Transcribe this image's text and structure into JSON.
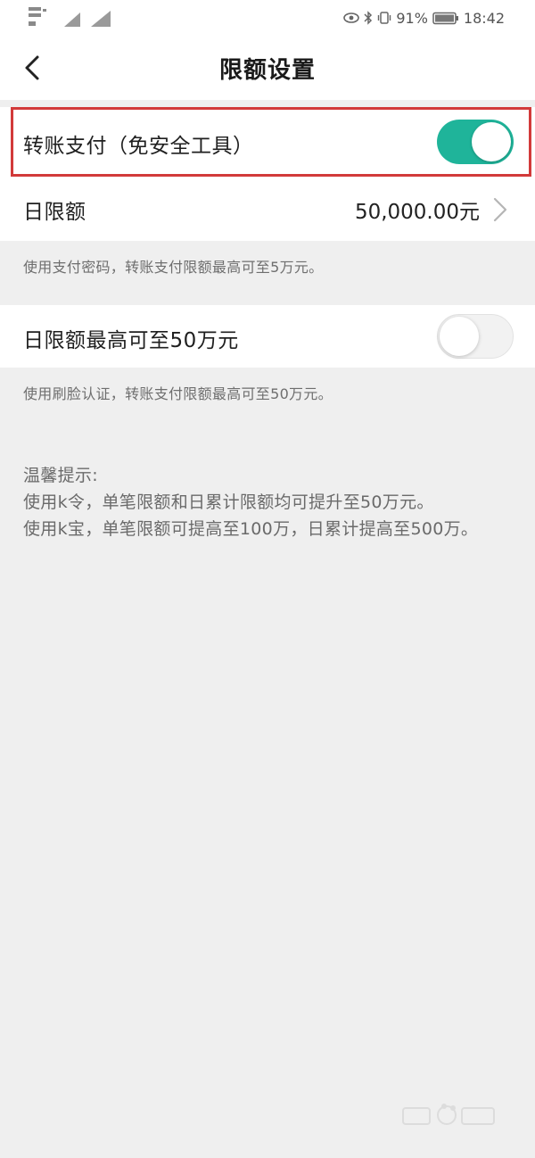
{
  "status_bar": {
    "battery_percent": "91%",
    "time": "18:42",
    "icons": [
      "signal-icon",
      "eye-icon",
      "bluetooth-icon",
      "vibrate-icon",
      "battery-icon"
    ]
  },
  "header": {
    "title": "限额设置",
    "back_icon": "chevron-left-icon"
  },
  "transfer_payment": {
    "label": "转账支付（免安全工具）",
    "enabled": true
  },
  "daily_limit": {
    "label": "日限额",
    "value": "50,000.00元"
  },
  "note_password": "使用支付密码，转账支付限额最高可至5万元。",
  "max_limit": {
    "label": "日限额最高可至50万元",
    "enabled": false
  },
  "note_face": "使用刷脸认证，转账支付限额最高可至50万元。",
  "tips": {
    "title": "温馨提示:",
    "line1": "使用k令，单笔限额和日累计限额均可提升至50万元。",
    "line2": "使用k宝，单笔限额可提高至100万，日累计提高至500万。"
  },
  "colors": {
    "accent": "#1fb49a",
    "highlight_border": "#d23a3a",
    "background": "#efefef"
  }
}
